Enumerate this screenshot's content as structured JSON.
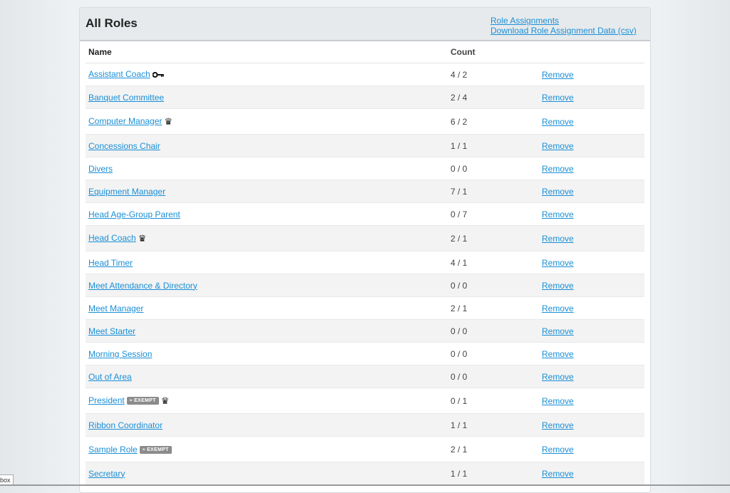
{
  "panel": {
    "title": "All Roles",
    "links": [
      "Role Assignments",
      "Download Role Assignment Data (csv)"
    ]
  },
  "table": {
    "headers": {
      "name": "Name",
      "count": "Count"
    },
    "remove_label": "Remove",
    "badge_label": "≈ EXEMPT",
    "rows": [
      {
        "name": "Assistant Coach",
        "count": "4 / 2",
        "icon": "key-icon"
      },
      {
        "name": "Banquet Committee",
        "count": "2 / 4"
      },
      {
        "name": "Computer Manager",
        "count": "6 / 2",
        "icon": "crown-icon"
      },
      {
        "name": "Concessions Chair",
        "count": "1 / 1"
      },
      {
        "name": "Divers",
        "count": "0 / 0"
      },
      {
        "name": "Equipment Manager",
        "count": "7 / 1"
      },
      {
        "name": "Head Age-Group Parent",
        "count": "0 / 7"
      },
      {
        "name": "Head Coach",
        "count": "2 / 1",
        "icon": "crown-icon"
      },
      {
        "name": "Head Timer",
        "count": "4 / 1"
      },
      {
        "name": "Meet Attendance & Directory",
        "count": "0 / 0"
      },
      {
        "name": "Meet Manager",
        "count": "2 / 1"
      },
      {
        "name": "Meet Starter",
        "count": "0 / 0"
      },
      {
        "name": "Morning Session",
        "count": "0 / 0"
      },
      {
        "name": "Out of Area",
        "count": "0 / 0"
      },
      {
        "name": "President",
        "count": "0 / 1",
        "badge": true,
        "icon": "crown-icon"
      },
      {
        "name": "Ribbon Coordinator",
        "count": "1 / 1"
      },
      {
        "name": "Sample Role",
        "count": "2 / 1",
        "badge": true
      },
      {
        "name": "Secretary",
        "count": "1 / 1"
      }
    ]
  },
  "corner_tab": "box"
}
